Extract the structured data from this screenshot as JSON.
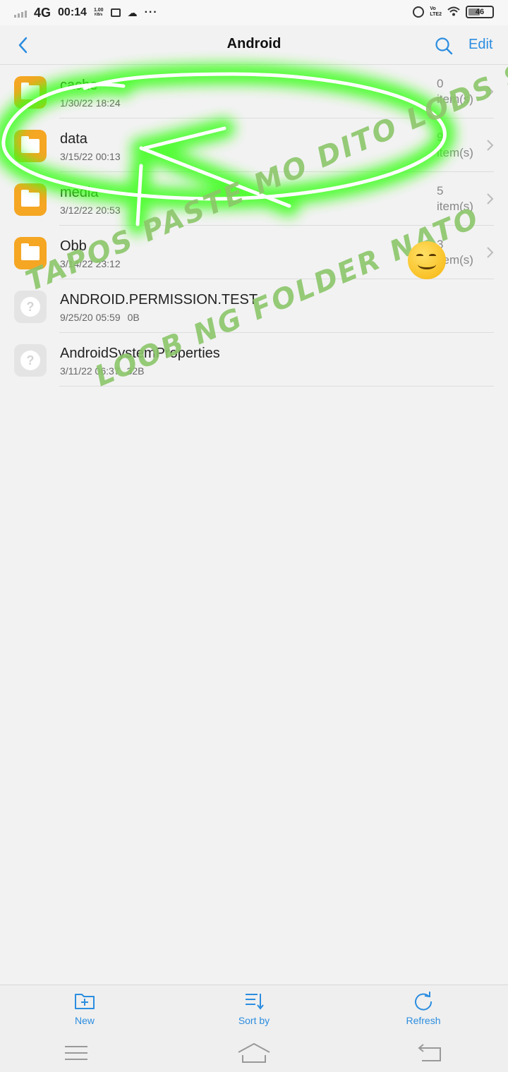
{
  "status_bar": {
    "network": "4G",
    "time": "00:14",
    "speed_value": "1.00",
    "speed_unit": "KB/s",
    "more": "···",
    "lte_top": "Vo",
    "lte_bottom": "LTE2",
    "battery": "46"
  },
  "header": {
    "title": "Android",
    "edit_label": "Edit"
  },
  "files": [
    {
      "name": "cache",
      "meta": "1/30/22 18:24",
      "size": "",
      "count": "0",
      "count_unit": "item(s)",
      "type": "folder"
    },
    {
      "name": "data",
      "meta": "3/15/22 00:13",
      "size": "",
      "count": "9",
      "count_unit": "item(s)",
      "type": "folder"
    },
    {
      "name": "media",
      "meta": "3/12/22 20:53",
      "size": "",
      "count": "5",
      "count_unit": "item(s)",
      "type": "folder"
    },
    {
      "name": "Obb",
      "meta": "3/14/22 23:12",
      "size": "",
      "count": "3",
      "count_unit": "item(s)",
      "type": "folder"
    },
    {
      "name": "ANDROID.PERMISSION.TEST",
      "meta": "9/25/20 05:59",
      "size": "0B",
      "count": "",
      "count_unit": "",
      "type": "unknown"
    },
    {
      "name": "AndroidSystemProperties",
      "meta": "3/11/22 06:37",
      "size": "32B",
      "count": "",
      "count_unit": "",
      "type": "unknown"
    }
  ],
  "toolbar": {
    "new_label": "New",
    "sort_label": "Sort by",
    "refresh_label": "Refresh"
  },
  "annotation": {
    "line1": "TAPOS PASTE MO DITO LODS SA",
    "line2": "LOOB NG FOLDER NATO"
  },
  "colors": {
    "accent": "#2b8de0",
    "folder": "#f5a623",
    "highlight": "#39ff14",
    "handwriting": "#8cc66a"
  }
}
